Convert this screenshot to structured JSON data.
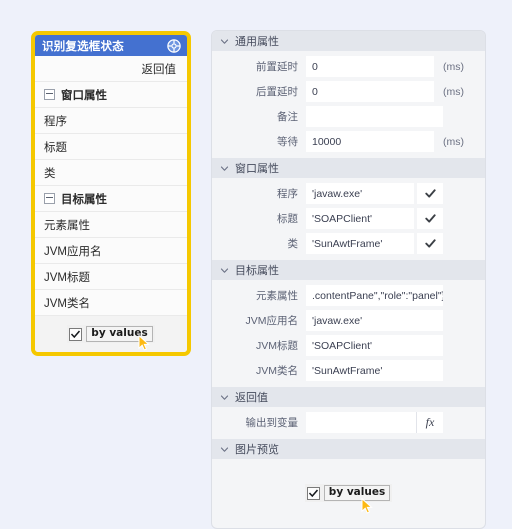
{
  "theme": {
    "page_bg": "#eef1fa",
    "accent_blue": "#4471d0",
    "highlight_yellow": "#f5c800",
    "section_header_bg": "#e3e6ec"
  },
  "left_panel": {
    "title": "识别复选框状态",
    "title_icon": "crosshair-move-icon",
    "rows": [
      {
        "label": "返回值",
        "type": "value-right",
        "icon": null
      },
      {
        "label": "窗口属性",
        "type": "group",
        "icon": "collapse-box-icon"
      },
      {
        "label": "程序",
        "type": "item",
        "icon": null
      },
      {
        "label": "标题",
        "type": "item",
        "icon": null
      },
      {
        "label": "类",
        "type": "item",
        "icon": null
      },
      {
        "label": "目标属性",
        "type": "group",
        "icon": "collapse-box-icon"
      },
      {
        "label": "元素属性",
        "type": "item",
        "icon": null
      },
      {
        "label": "JVM应用名",
        "type": "item",
        "icon": null
      },
      {
        "label": "JVM标题",
        "type": "item",
        "icon": null
      },
      {
        "label": "JVM类名",
        "type": "item",
        "icon": null
      }
    ],
    "preview": {
      "checkbox_checked": true,
      "checkbox_label": "by values",
      "cursor_icon": "mouse-pointer-icon"
    }
  },
  "right_panel": {
    "sections": [
      {
        "title": "通用属性",
        "chevron": "chevron-down-icon",
        "fields": [
          {
            "label": "前置延时",
            "value": "0",
            "placeholder": "",
            "unit": "(ms)",
            "trailing": "unit"
          },
          {
            "label": "后置延时",
            "value": "0",
            "placeholder": "",
            "unit": "(ms)",
            "trailing": "unit"
          },
          {
            "label": "备注",
            "value": "",
            "placeholder": "",
            "unit": "",
            "trailing": "none"
          },
          {
            "label": "等待",
            "value": "10000",
            "placeholder": "",
            "unit": "(ms)",
            "trailing": "unit"
          }
        ]
      },
      {
        "title": "窗口属性",
        "chevron": "chevron-down-icon",
        "fields": [
          {
            "label": "程序",
            "value": "'javaw.exe'",
            "placeholder": "",
            "unit": "",
            "trailing": "check"
          },
          {
            "label": "标题",
            "value": "'SOAPClient'",
            "placeholder": "",
            "unit": "",
            "trailing": "check"
          },
          {
            "label": "类",
            "value": "'SunAwtFrame'",
            "placeholder": "",
            "unit": "",
            "trailing": "check"
          }
        ]
      },
      {
        "title": "目标属性",
        "chevron": "chevron-down-icon",
        "fields": [
          {
            "label": "元素属性",
            "value": ".contentPane\",\"role\":\"panel\"}]",
            "placeholder": "",
            "unit": "",
            "trailing": "none"
          },
          {
            "label": "JVM应用名",
            "value": "'javaw.exe'",
            "placeholder": "",
            "unit": "",
            "trailing": "none"
          },
          {
            "label": "JVM标题",
            "value": "'SOAPClient'",
            "placeholder": "",
            "unit": "",
            "trailing": "none"
          },
          {
            "label": "JVM类名",
            "value": "'SunAwtFrame'",
            "placeholder": "",
            "unit": "",
            "trailing": "none"
          }
        ]
      },
      {
        "title": "返回值",
        "chevron": "chevron-down-icon",
        "fields": [
          {
            "label": "输出到变量",
            "value": "",
            "placeholder": "",
            "unit": "",
            "trailing": "fx",
            "fx_label": "fx"
          }
        ]
      },
      {
        "title": "图片预览",
        "chevron": "chevron-down-icon",
        "fields": [],
        "preview": {
          "checkbox_checked": true,
          "checkbox_label": "by values",
          "cursor_icon": "mouse-pointer-icon"
        }
      }
    ]
  }
}
